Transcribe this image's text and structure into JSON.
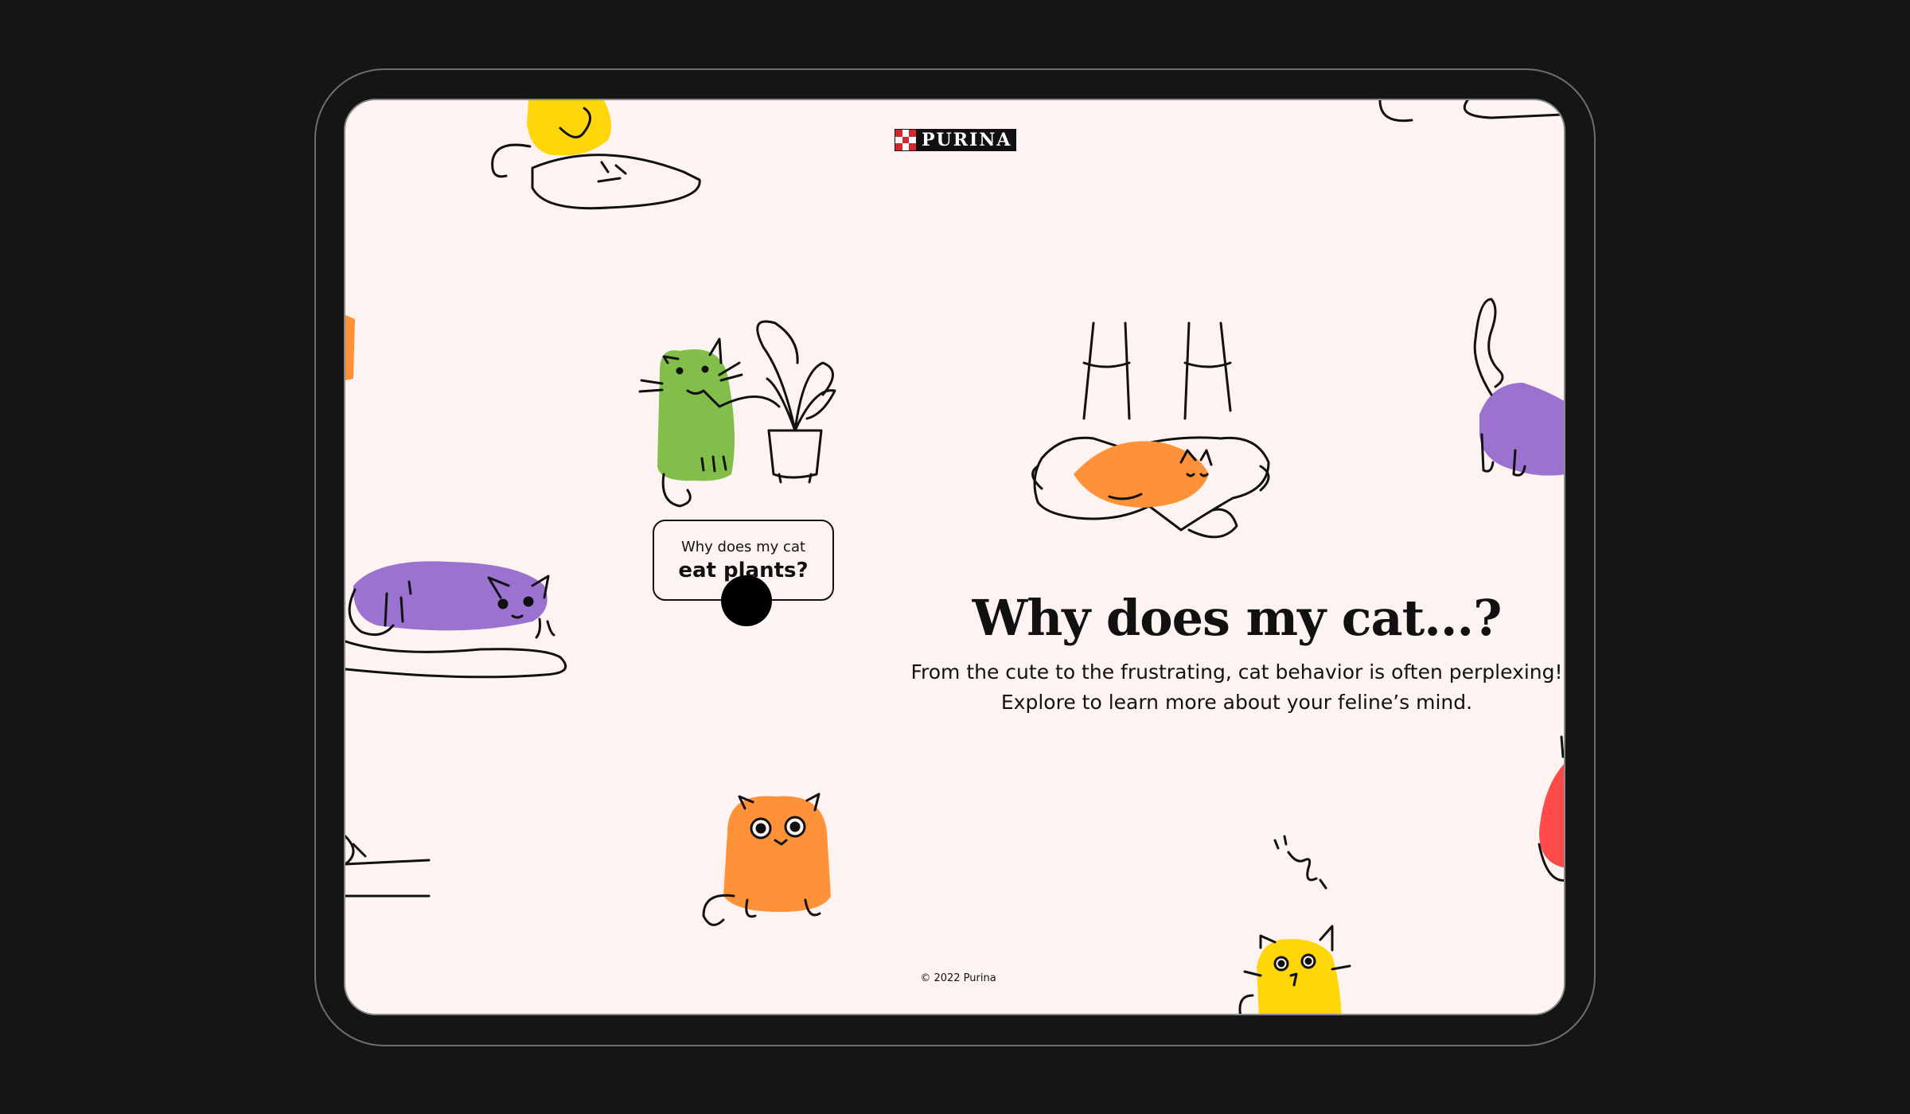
{
  "brand": {
    "logo_text": "PURINA"
  },
  "hero": {
    "title": "Why does my cat...?",
    "subtitle_line1": "From the cute to the frustrating, cat behavior is often perplexing!",
    "subtitle_line2": "Explore to learn more about your feline’s mind."
  },
  "question_card": {
    "line1": "Why does my cat",
    "line2": "eat plants?"
  },
  "footer": {
    "copyright": "© 2022 Purina"
  },
  "colors": {
    "green": "#82be4a",
    "orange": "#ff9138",
    "purple": "#9b72cf",
    "yellow": "#ffd60a",
    "red": "#ff4a4a",
    "background": "#fdf4f2"
  }
}
